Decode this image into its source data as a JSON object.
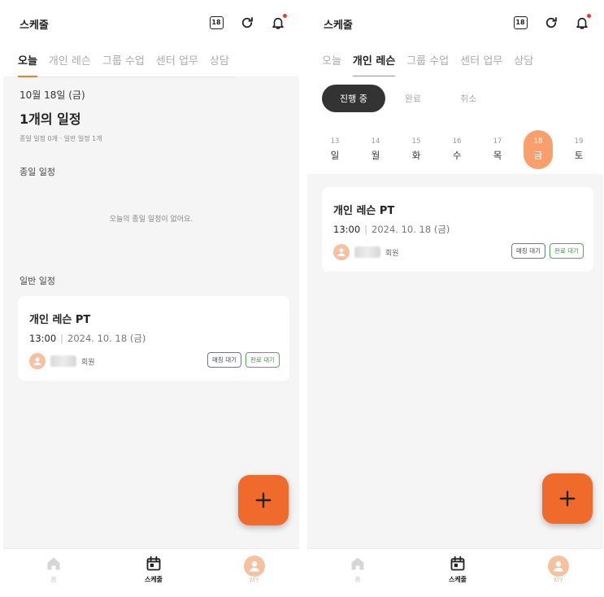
{
  "app_title": "스케줄",
  "calendar_badge": "18",
  "tabs": [
    "오늘",
    "개인 레슨",
    "그룹 수업",
    "센터 업무",
    "상담"
  ],
  "left": {
    "date_line": "10월 18일 (금)",
    "count_title": "1개의 일정",
    "count_sub": "종일 일정 0개 · 일반 일정 1개",
    "allday_label": "종일 일정",
    "allday_empty": "오늘의 종일 일정이 없어요.",
    "regular_label": "일반 일정"
  },
  "right": {
    "filters": [
      "진행 중",
      "완료",
      "취소"
    ],
    "days": [
      {
        "num": "13",
        "name": "일"
      },
      {
        "num": "14",
        "name": "월"
      },
      {
        "num": "15",
        "name": "화"
      },
      {
        "num": "16",
        "name": "수"
      },
      {
        "num": "17",
        "name": "목"
      },
      {
        "num": "18",
        "name": "금"
      },
      {
        "num": "19",
        "name": "토"
      }
    ]
  },
  "card": {
    "title": "개인 레슨 PT",
    "time": "13:00",
    "separator": "|",
    "date": "2024. 10. 18 (금)",
    "member_suffix": "회원",
    "badge_match": "매칭 대기",
    "badge_complete": "완료 대기"
  },
  "nav": {
    "home": "홈",
    "schedule": "스케줄",
    "my": "MY"
  },
  "colors": {
    "accent": "#f06a2c",
    "selected_day": "#f7a06e",
    "complete_badge": "#4caf50"
  }
}
